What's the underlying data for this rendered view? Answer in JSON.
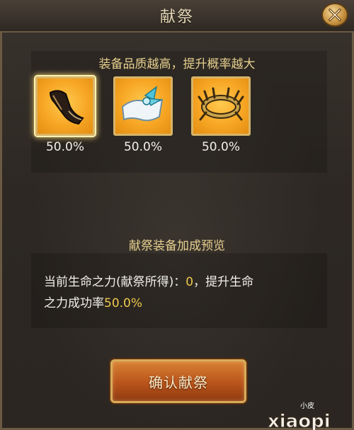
{
  "dialog": {
    "title": "献祭",
    "close_icon": "close-icon"
  },
  "quality_section": {
    "heading": "装备品质越高，提升概率越大",
    "items": [
      {
        "icon": "greave-icon",
        "percent": "50.0%"
      },
      {
        "icon": "ribbon-cloth-icon",
        "percent": "50.0%"
      },
      {
        "icon": "golden-ring-icon",
        "percent": "50.0%"
      }
    ]
  },
  "bonus_section": {
    "heading": "献祭装备加成预览",
    "line1_prefix": "当前生命之力(献祭所得)：",
    "life_force_value": "0",
    "line1_suffix": "，提升生命",
    "line2_prefix": "之力成功率",
    "success_rate": "50.0%"
  },
  "confirm_button": {
    "label": "确认献祭"
  },
  "watermark": {
    "small_text": "小皮",
    "large_text": "xiaopi"
  },
  "colors": {
    "accent_gold": "#e6cf8e",
    "highlight": "#f0c94d",
    "item_bg": "#f7a624",
    "button": "#b9541b"
  }
}
